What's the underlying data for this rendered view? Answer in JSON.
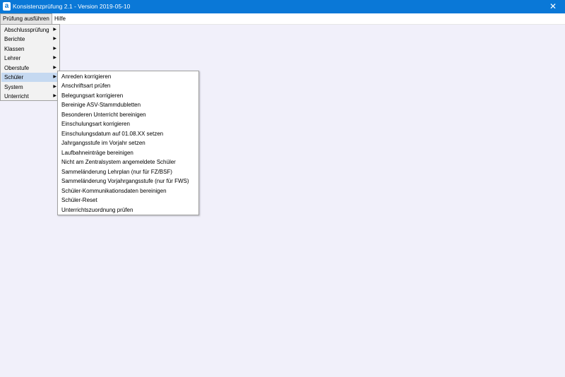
{
  "window": {
    "title": "Konsistenzprüfung 2.1 - Version 2019-05-10",
    "app_icon_letter": "a",
    "close_glyph": "✕"
  },
  "menubar": {
    "items": [
      {
        "label": "Prüfung ausführen"
      },
      {
        "label": "Hilfe"
      }
    ]
  },
  "main_menu": {
    "items": [
      {
        "label": "Abschlussprüfung",
        "submenu_icon": "chevron-right-icon"
      },
      {
        "label": "Berichte",
        "submenu_icon": "chevron-right-icon"
      },
      {
        "label": "Klassen",
        "submenu_icon": "chevron-right-icon"
      },
      {
        "label": "Lehrer",
        "submenu_icon": "chevron-right-icon"
      },
      {
        "label": "Oberstufe",
        "submenu_icon": "chevron-right-icon"
      },
      {
        "label": "Schüler",
        "submenu_icon": "chevron-right-icon"
      },
      {
        "label": "System",
        "submenu_icon": "chevron-right-icon"
      },
      {
        "label": "Unterricht",
        "submenu_icon": "chevron-right-icon"
      }
    ],
    "arrow_glyph": "▶"
  },
  "schueler_submenu": {
    "items": [
      "Anreden korrigieren",
      "Anschriftsart prüfen",
      "Belegungsart korrigieren",
      "Bereinige ASV-Stammdubletten",
      "Besonderen Unterricht bereinigen",
      "Einschulungsart korrigieren",
      "Einschulungsdatum auf 01.08.XX setzen",
      "Jahrgangsstufe im Vorjahr setzen",
      "Laufbahneinträge bereinigen",
      "Nicht am Zentralsystem angemeldete Schüler",
      "Sammeländerung Lehrplan (nur für FZ/BSF)",
      "Sammeländerung Vorjahrgangsstufe (nur für FWS)",
      "Schüler-Kommunikationsdaten bereinigen",
      "Schüler-Reset",
      "Unterrichtszuordnung prüfen"
    ]
  },
  "colors": {
    "titlebar": "#0a78d7",
    "background": "#f1f0fa",
    "highlight": "#c5d9f1"
  }
}
